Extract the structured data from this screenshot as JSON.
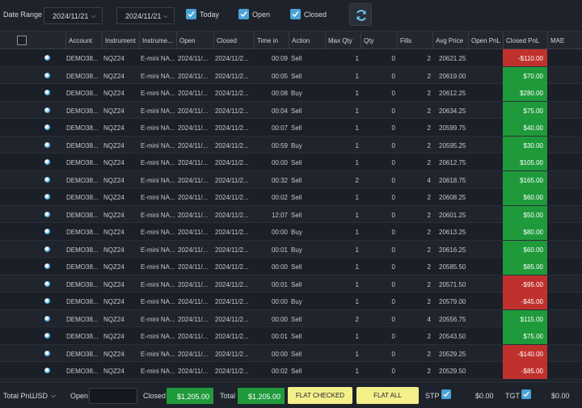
{
  "toolbar": {
    "date_range_label": "Date Range",
    "date_from": "2024/11/21",
    "date_to": "2024/11/21",
    "filters": [
      {
        "label": "Today",
        "checked": true
      },
      {
        "label": "Open",
        "checked": true
      },
      {
        "label": "Closed",
        "checked": true
      }
    ],
    "refresh_icon": "refresh-icon"
  },
  "table": {
    "headers": [
      "Account",
      "Instrument",
      "Instrume...",
      "Open",
      "Closed",
      "Time in",
      "Action",
      "Max Qty",
      "Qty",
      "Fills",
      "Avg Price",
      "Open PnL",
      "Closed PnL",
      "MAE"
    ],
    "rows": [
      {
        "account": "DEMO38...",
        "instrument": "NQZ24",
        "instrument_name": "E-mini NA...",
        "open": "2024/11/...",
        "closed": "2024/11/2...",
        "time_in": "00:09",
        "action": "Sell",
        "max_qty": "1",
        "qty": "0",
        "fills": "2",
        "avg_price": "20621.25",
        "open_pnl": "",
        "closed_pnl": "-$110.00",
        "pnl_sign": "neg"
      },
      {
        "account": "DEMO38...",
        "instrument": "NQZ24",
        "instrument_name": "E-mini NA...",
        "open": "2024/11/...",
        "closed": "2024/11/2...",
        "time_in": "00:05",
        "action": "Sell",
        "max_qty": "1",
        "qty": "0",
        "fills": "2",
        "avg_price": "20619.00",
        "open_pnl": "",
        "closed_pnl": "$70.00",
        "pnl_sign": "pos"
      },
      {
        "account": "DEMO38...",
        "instrument": "NQZ24",
        "instrument_name": "E-mini NA...",
        "open": "2024/11/...",
        "closed": "2024/11/2...",
        "time_in": "00:08",
        "action": "Buy",
        "max_qty": "1",
        "qty": "0",
        "fills": "2",
        "avg_price": "20612.25",
        "open_pnl": "",
        "closed_pnl": "$280.00",
        "pnl_sign": "pos"
      },
      {
        "account": "DEMO38...",
        "instrument": "NQZ24",
        "instrument_name": "E-mini NA...",
        "open": "2024/11/...",
        "closed": "2024/11/2...",
        "time_in": "00:04",
        "action": "Sell",
        "max_qty": "1",
        "qty": "0",
        "fills": "2",
        "avg_price": "20634.25",
        "open_pnl": "",
        "closed_pnl": "$75.00",
        "pnl_sign": "pos"
      },
      {
        "account": "DEMO38...",
        "instrument": "NQZ24",
        "instrument_name": "E-mini NA...",
        "open": "2024/11/...",
        "closed": "2024/11/2...",
        "time_in": "00:07",
        "action": "Sell",
        "max_qty": "1",
        "qty": "0",
        "fills": "2",
        "avg_price": "20599.75",
        "open_pnl": "",
        "closed_pnl": "$40.00",
        "pnl_sign": "pos"
      },
      {
        "account": "DEMO38...",
        "instrument": "NQZ24",
        "instrument_name": "E-mini NA...",
        "open": "2024/11/...",
        "closed": "2024/11/2...",
        "time_in": "00:59",
        "action": "Buy",
        "max_qty": "1",
        "qty": "0",
        "fills": "2",
        "avg_price": "20595.25",
        "open_pnl": "",
        "closed_pnl": "$30.00",
        "pnl_sign": "pos"
      },
      {
        "account": "DEMO38...",
        "instrument": "NQZ24",
        "instrument_name": "E-mini NA...",
        "open": "2024/11/...",
        "closed": "2024/11/2...",
        "time_in": "00:00",
        "action": "Sell",
        "max_qty": "1",
        "qty": "0",
        "fills": "2",
        "avg_price": "20612.75",
        "open_pnl": "",
        "closed_pnl": "$105.00",
        "pnl_sign": "pos"
      },
      {
        "account": "DEMO38...",
        "instrument": "NQZ24",
        "instrument_name": "E-mini NA...",
        "open": "2024/11/...",
        "closed": "2024/11/2...",
        "time_in": "00:32",
        "action": "Sell",
        "max_qty": "2",
        "qty": "0",
        "fills": "4",
        "avg_price": "20618.75",
        "open_pnl": "",
        "closed_pnl": "$165.00",
        "pnl_sign": "pos"
      },
      {
        "account": "DEMO38...",
        "instrument": "NQZ24",
        "instrument_name": "E-mini NA...",
        "open": "2024/11/...",
        "closed": "2024/11/2...",
        "time_in": "00:02",
        "action": "Sell",
        "max_qty": "1",
        "qty": "0",
        "fills": "2",
        "avg_price": "20608.25",
        "open_pnl": "",
        "closed_pnl": "$60.00",
        "pnl_sign": "pos"
      },
      {
        "account": "DEMO38...",
        "instrument": "NQZ24",
        "instrument_name": "E-mini NA...",
        "open": "2024/11/...",
        "closed": "2024/11/2...",
        "time_in": "12:07",
        "action": "Sell",
        "max_qty": "1",
        "qty": "0",
        "fills": "2",
        "avg_price": "20601.25",
        "open_pnl": "",
        "closed_pnl": "$50.00",
        "pnl_sign": "pos"
      },
      {
        "account": "DEMO38...",
        "instrument": "NQZ24",
        "instrument_name": "E-mini NA...",
        "open": "2024/11/...",
        "closed": "2024/11/2...",
        "time_in": "00:00",
        "action": "Buy",
        "max_qty": "1",
        "qty": "0",
        "fills": "2",
        "avg_price": "20613.25",
        "open_pnl": "",
        "closed_pnl": "$80.00",
        "pnl_sign": "pos"
      },
      {
        "account": "DEMO38...",
        "instrument": "NQZ24",
        "instrument_name": "E-mini NA...",
        "open": "2024/11/...",
        "closed": "2024/11/2...",
        "time_in": "00:01",
        "action": "Buy",
        "max_qty": "1",
        "qty": "0",
        "fills": "2",
        "avg_price": "20616.25",
        "open_pnl": "",
        "closed_pnl": "$60.00",
        "pnl_sign": "pos"
      },
      {
        "account": "DEMO38...",
        "instrument": "NQZ24",
        "instrument_name": "E-mini NA...",
        "open": "2024/11/...",
        "closed": "2024/11/2...",
        "time_in": "00:00",
        "action": "Sell",
        "max_qty": "1",
        "qty": "0",
        "fills": "2",
        "avg_price": "20585.50",
        "open_pnl": "",
        "closed_pnl": "$85.00",
        "pnl_sign": "pos"
      },
      {
        "account": "DEMO38...",
        "instrument": "NQZ24",
        "instrument_name": "E-mini NA...",
        "open": "2024/11/...",
        "closed": "2024/11/2...",
        "time_in": "00:01",
        "action": "Sell",
        "max_qty": "1",
        "qty": "0",
        "fills": "2",
        "avg_price": "20571.50",
        "open_pnl": "",
        "closed_pnl": "-$95.00",
        "pnl_sign": "neg"
      },
      {
        "account": "DEMO38...",
        "instrument": "NQZ24",
        "instrument_name": "E-mini NA...",
        "open": "2024/11/...",
        "closed": "2024/11/2...",
        "time_in": "00:00",
        "action": "Buy",
        "max_qty": "1",
        "qty": "0",
        "fills": "2",
        "avg_price": "20579.00",
        "open_pnl": "",
        "closed_pnl": "-$45.00",
        "pnl_sign": "neg"
      },
      {
        "account": "DEMO38...",
        "instrument": "NQZ24",
        "instrument_name": "E-mini NA...",
        "open": "2024/11/...",
        "closed": "2024/11/2...",
        "time_in": "00:00",
        "action": "Sell",
        "max_qty": "2",
        "qty": "0",
        "fills": "4",
        "avg_price": "20556.75",
        "open_pnl": "",
        "closed_pnl": "$115.00",
        "pnl_sign": "pos"
      },
      {
        "account": "DEMO38...",
        "instrument": "NQZ24",
        "instrument_name": "E-mini NA...",
        "open": "2024/11/...",
        "closed": "2024/11/2...",
        "time_in": "00:01",
        "action": "Sell",
        "max_qty": "1",
        "qty": "0",
        "fills": "2",
        "avg_price": "20543.50",
        "open_pnl": "",
        "closed_pnl": "$75.00",
        "pnl_sign": "pos"
      },
      {
        "account": "DEMO38...",
        "instrument": "NQZ24",
        "instrument_name": "E-mini NA...",
        "open": "2024/11/...",
        "closed": "2024/11/2...",
        "time_in": "00:00",
        "action": "Sell",
        "max_qty": "1",
        "qty": "0",
        "fills": "2",
        "avg_price": "20529.25",
        "open_pnl": "",
        "closed_pnl": "-$140.00",
        "pnl_sign": "neg"
      },
      {
        "account": "DEMO38...",
        "instrument": "NQZ24",
        "instrument_name": "E-mini NA...",
        "open": "2024/11/...",
        "closed": "2024/11/2...",
        "time_in": "00:02",
        "action": "Sell",
        "max_qty": "1",
        "qty": "0",
        "fills": "2",
        "avg_price": "20529.50",
        "open_pnl": "",
        "closed_pnl": "-$85.00",
        "pnl_sign": "neg"
      }
    ]
  },
  "footer": {
    "total_pnl_label": "Total PnL",
    "currency": "USD",
    "open_label": "Open",
    "open_value": "",
    "closed_label": "Closed",
    "closed_value": "$1,205.00",
    "total_label": "Total",
    "total_value": "$1,205.00",
    "flat_checked_label": "FLAT CHECKED",
    "flat_all_label": "FLAT ALL",
    "stp_label": "STP",
    "stp_checked": true,
    "stp_value": "$0.00",
    "tgt_label": "TGT",
    "tgt_checked": true,
    "tgt_value": "$0.00"
  },
  "colors": {
    "positive": "#1f9a3a",
    "negative": "#c0312d",
    "accent": "#4aa3d8",
    "flat_button": "#f3f08a"
  }
}
